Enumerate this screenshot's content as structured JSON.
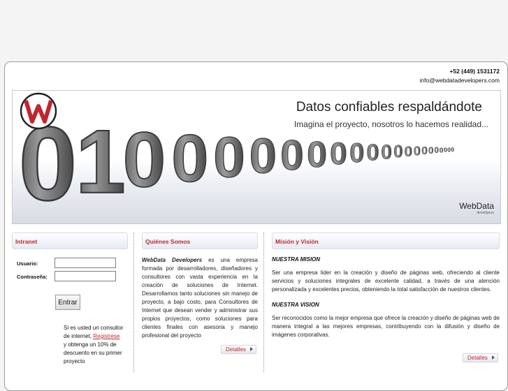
{
  "contact": {
    "phone": "+52 (449) 1531172",
    "email": "info@webdatadevelopers.com"
  },
  "banner": {
    "title": "Datos confiables respaldándote",
    "subtitle": "Imagina el proyecto, nosotros lo hacemos realidad...",
    "logo_text": "WebData",
    "logo_sub": "developers",
    "digits": [
      "0",
      "1",
      "0",
      "0",
      "0",
      "0",
      "0",
      "0",
      "0",
      "0",
      "0",
      "0",
      "0",
      "0",
      "0",
      "0",
      "0",
      "0",
      "0",
      "0",
      "0",
      "0"
    ]
  },
  "intranet": {
    "title": "Intranet",
    "user_label": "Usuario:",
    "password_label": "Contraseña:",
    "user_value": "",
    "password_value": "",
    "submit_label": "Entrar",
    "note_before": "Si es usted un consultor de internet,",
    "note_link": "Registrese",
    "note_after": "y obtenga un 10% de descuento en su primer proyecto"
  },
  "about": {
    "title": "Quiénes Somos",
    "company": "WebData Developers",
    "text": "es una empresa formada por desarrolladores, diseñadores y consultores con vasta experiencia en la creación de soluciones de Internet. Desarrollamos tanto soluciones sin manejo de proyecto, a bajo costo, para Consultores de Internet que desean vender y administrar sus propios proyectos, como soluciones para clientes finales con asesoria y manejo profesional del proyecto",
    "more_label": "Detalles"
  },
  "mission": {
    "title": "Misión y Visión",
    "mission_heading": "NUESTRA MISION",
    "mission_text": "Ser una empresa lider en la creación y diseño de páginas web, ofreciendo al cliente servicios y soluciones integrales de excelente calidad, a través de una atención personalizada y excelentes precios, obteniendo la total satisfacción de nuestros clientes.",
    "vision_heading": "NUESTRA VISION",
    "vision_text": "Ser reconocidos como la mejor empresa que ofrece la creación y diseño de páginas web de manera integral a las mejores empresas, contribuyendo con la difusión y diseño de imágenes corporativas.",
    "more_label": "Detalles"
  },
  "colors": {
    "accent": "#c0262e",
    "border": "#9a9a9a"
  }
}
